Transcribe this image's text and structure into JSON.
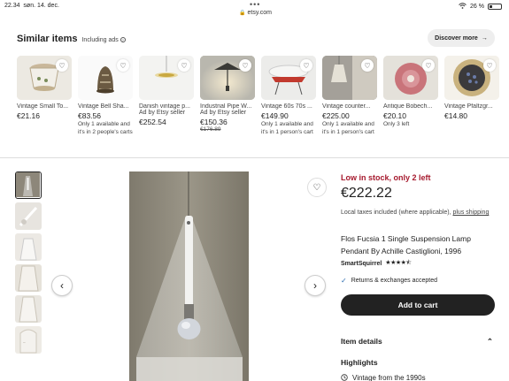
{
  "status_bar": {
    "time": "22.34",
    "date": "søn. 14. dec.",
    "url": "etsy.com",
    "battery": "26 %"
  },
  "similar": {
    "title": "Similar items",
    "including_ads": "Including ads",
    "discover_label": "Discover more",
    "items": [
      {
        "name": "Vintage Small To...",
        "price": "€21.16",
        "orig": "",
        "ad": "",
        "note": ""
      },
      {
        "name": "Vintage Bell Sha...",
        "price": "€83.56",
        "orig": "",
        "ad": "",
        "note": "Only 1 available and it's in 2 people's carts"
      },
      {
        "name": "Danish vintage p...",
        "price": "€252.54",
        "orig": "",
        "ad": "Ad by Etsy seller",
        "note": ""
      },
      {
        "name": "Industrial Pipe W...",
        "price": "€150.36",
        "orig": "€176.89",
        "ad": "Ad by Etsy seller",
        "note": ""
      },
      {
        "name": "Vintage 60s 70s ...",
        "price": "€149.90",
        "orig": "",
        "ad": "",
        "note": "Only 1 available and it's in 1 person's cart"
      },
      {
        "name": "Vintage counter...",
        "price": "€225.00",
        "orig": "",
        "ad": "",
        "note": "Only 1 available and it's in 1 person's cart"
      },
      {
        "name": "Antique Bobech...",
        "price": "€20.10",
        "orig": "",
        "ad": "",
        "note": "Only 3 left"
      },
      {
        "name": "Vintage Pfaltzgr...",
        "price": "€14.80",
        "orig": "",
        "ad": "",
        "note": ""
      }
    ]
  },
  "listing": {
    "stock": "Low in stock, only 2 left",
    "price": "€222.22",
    "tax_text": "Local taxes included (where applicable),",
    "tax_link": "plus shipping",
    "title": "Flos Fucsia 1 Single Suspension Lamp Pendant By Achille Castiglioni, 1996",
    "seller": "SmartSquirrel",
    "rating": 4.5,
    "rating_stars": "★★★★⯪",
    "returns": "Returns & exchanges accepted",
    "add_to_cart": "Add to cart",
    "item_details": "Item details",
    "highlights": "Highlights",
    "vintage": "Vintage from the 1990s"
  },
  "colors": {
    "stock_red": "#a61a2e",
    "button_dark": "#222222"
  }
}
